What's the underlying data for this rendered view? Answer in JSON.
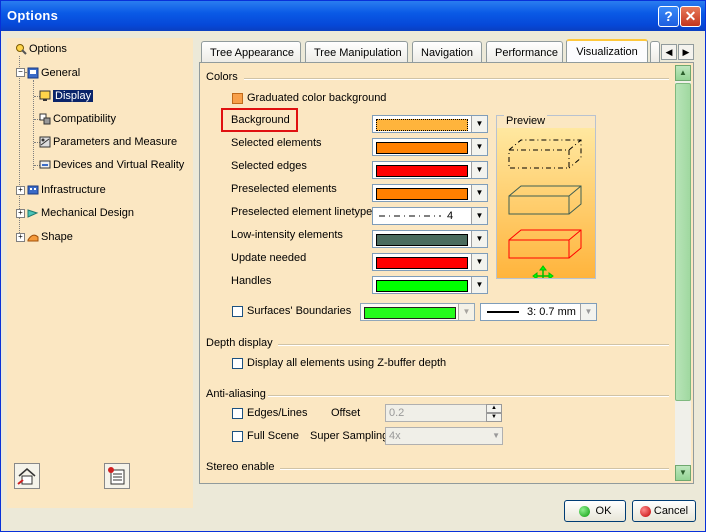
{
  "window": {
    "title": "Options"
  },
  "titlebar": {
    "help_glyph": "?",
    "close_glyph": "✕"
  },
  "tree": {
    "root": "Options",
    "items": [
      {
        "label": "General"
      },
      {
        "label": "Display",
        "selected": true
      },
      {
        "label": "Compatibility"
      },
      {
        "label": "Parameters and Measure"
      },
      {
        "label": "Devices and Virtual Reality"
      },
      {
        "label": "Infrastructure"
      },
      {
        "label": "Mechanical Design"
      },
      {
        "label": "Shape"
      }
    ]
  },
  "tabs": [
    "Tree Appearance",
    "Tree Manipulation",
    "Navigation",
    "Performance",
    "Visualization"
  ],
  "active_tab": "Visualization",
  "colors_section": {
    "title": "Colors",
    "graduated_label": "Graduated color background",
    "graduated_checked": true,
    "rows": [
      {
        "label": "Background",
        "color": "#ffb43c"
      },
      {
        "label": "Selected elements",
        "color": "#ff8000"
      },
      {
        "label": "Selected edges",
        "color": "#ff0000"
      },
      {
        "label": "Preselected elements",
        "color": "#ff8000"
      },
      {
        "label": "Preselected element linetype",
        "value": "4"
      },
      {
        "label": "Low-intensity elements",
        "color": "#4a6b5e"
      },
      {
        "label": "Update needed",
        "color": "#ff0000"
      },
      {
        "label": "Handles",
        "color": "#00ff00"
      }
    ],
    "preview_label": "Preview",
    "surfaces_label": "Surfaces' Boundaries",
    "surfaces_color": "#00ff00",
    "surfaces_thickness": "3: 0.7 mm"
  },
  "depth_section": {
    "title": "Depth display",
    "zbuffer_label": "Display all elements using Z-buffer depth"
  },
  "antialias_section": {
    "title": "Anti-aliasing",
    "edges_label": "Edges/Lines",
    "offset_label": "Offset",
    "offset_value": "0.2",
    "fullscene_label": "Full Scene",
    "supersampling_label": "Super Sampling",
    "supersampling_value": "4x"
  },
  "stereo_section": {
    "title": "Stereo enable"
  },
  "footer": {
    "ok_label": "OK",
    "cancel_label": "Cancel"
  }
}
